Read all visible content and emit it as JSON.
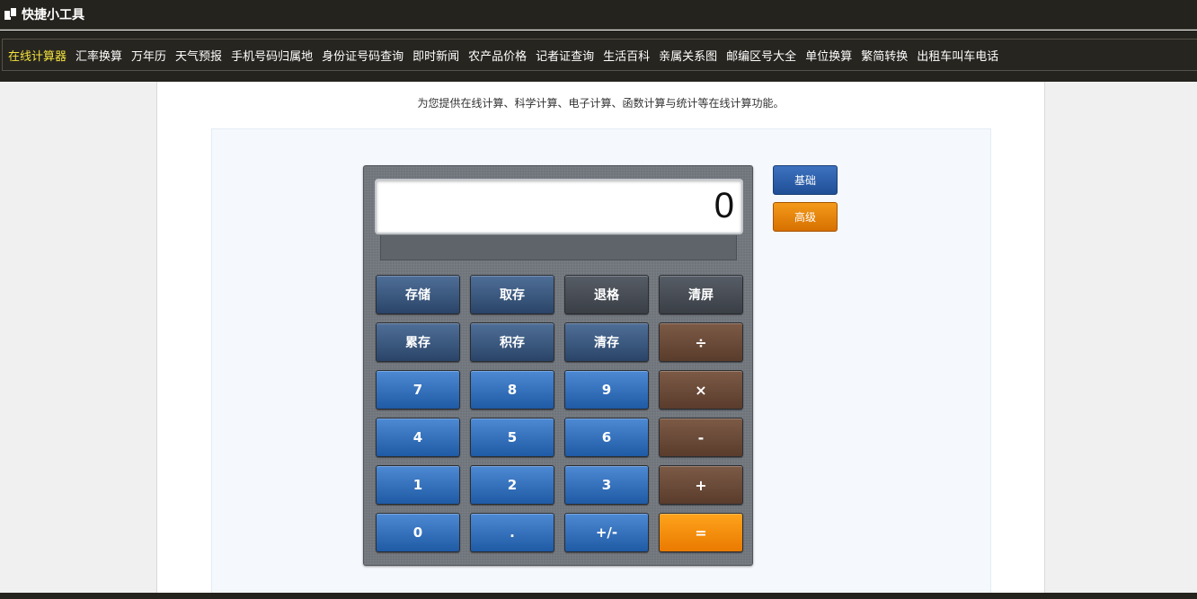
{
  "header": {
    "brand": "快捷小工具"
  },
  "nav": {
    "items": [
      "在线计算器",
      "汇率换算",
      "万年历",
      "天气预报",
      "手机号码归属地",
      "身份证号码查询",
      "即时新闻",
      "农产品价格",
      "记者证查询",
      "生活百科",
      "亲属关系图",
      "邮编区号大全",
      "单位换算",
      "繁简转换",
      "出租车叫车电话"
    ],
    "active_index": 0
  },
  "intro": "为您提供在线计算、科学计算、电子计算、函数计算与统计等在线计算功能。",
  "calculator": {
    "display": "0",
    "keys": {
      "mem_store": "存储",
      "mem_recall": "取存",
      "backspace": "退格",
      "clear_screen": "清屏",
      "mem_add": "累存",
      "mem_multiply": "积存",
      "mem_clear": "清存",
      "divide": "÷",
      "n7": "7",
      "n8": "8",
      "n9": "9",
      "multiply": "×",
      "n4": "4",
      "n5": "5",
      "n6": "6",
      "minus": "-",
      "n1": "1",
      "n2": "2",
      "n3": "3",
      "plus": "+",
      "n0": "0",
      "dot": ".",
      "negate": "+/-",
      "equals": "="
    }
  },
  "modes": {
    "basic": "基础",
    "advanced": "高级"
  },
  "colors": {
    "nav_active": "#f3e33e",
    "header_bg": "#25231d",
    "equals_orange": "#e97a00"
  }
}
